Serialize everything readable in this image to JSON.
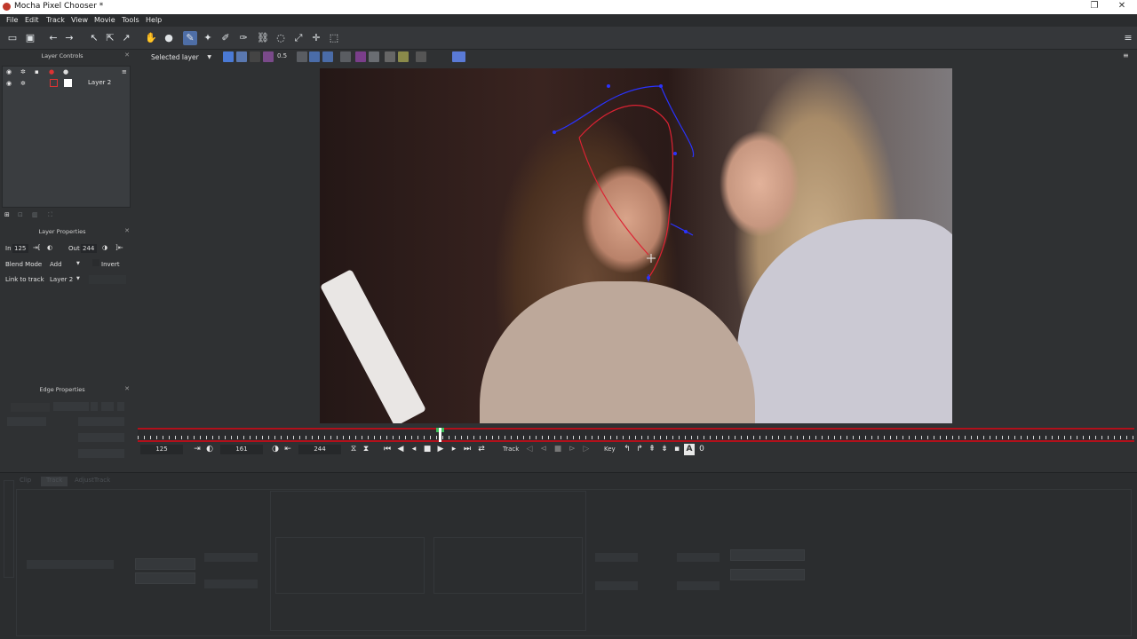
{
  "window": {
    "title": "Mocha Pixel Chooser *",
    "controls": [
      "❐",
      "✕"
    ]
  },
  "menu": [
    "File",
    "Edit",
    "Track",
    "View",
    "Movie",
    "Tools",
    "Help"
  ],
  "toolbar2": {
    "selected_layer": "Selected layer",
    "opacity": "0.5"
  },
  "layer_controls": {
    "title": "Layer Controls",
    "layers": [
      {
        "name": "Layer 2",
        "color": "#dd3333"
      }
    ]
  },
  "layer_properties": {
    "title": "Layer Properties",
    "in_label": "In",
    "in_value": "125",
    "out_label": "Out",
    "out_value": "244",
    "blend_label": "Blend Mode",
    "blend_value": "Add",
    "invert_label": "Invert",
    "link_label": "Link to track",
    "link_value": "Layer 2"
  },
  "edge_properties": {
    "title": "Edge Properties"
  },
  "timeline": {
    "current_frame": 161,
    "in_frame": 125,
    "out_frame": 244,
    "accent": "#b2101b"
  },
  "transport": {
    "in": "125",
    "current": "161",
    "out": "244",
    "track_label": "Track",
    "key_label": "Key"
  },
  "bottom_tabs": [
    "Clip",
    "Track",
    "AdjustTrack"
  ],
  "colors": {
    "accent_blue": "#4e6ea6",
    "spline_red": "#dd2233",
    "spline_blue": "#2a33ff"
  }
}
